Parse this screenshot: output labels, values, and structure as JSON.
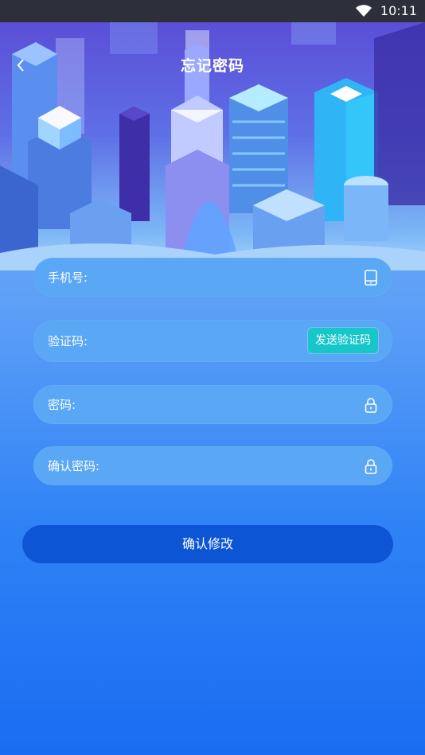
{
  "status_bar": {
    "time": "10:11"
  },
  "header": {
    "title": "忘记密码"
  },
  "form": {
    "phone": {
      "label": "手机号:",
      "value": ""
    },
    "code": {
      "label": "验证码:",
      "value": "",
      "send_label": "发送验证码"
    },
    "password": {
      "label": "密码:",
      "value": ""
    },
    "confirm": {
      "label": "确认密码:",
      "value": ""
    }
  },
  "submit_label": "确认修改",
  "colors": {
    "send_button": "#17c6c9",
    "submit_button": "#0c56d6",
    "field_bg": "#5aa7f6"
  }
}
